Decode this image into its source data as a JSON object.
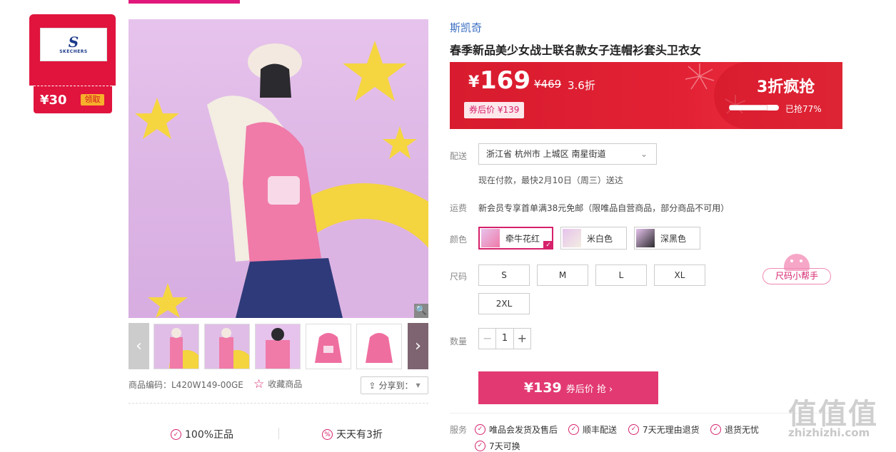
{
  "coupon": {
    "amount": "¥30",
    "claim_label": "领取",
    "brand_logo_text": "SKECHERS"
  },
  "product": {
    "brand": "斯凯奇",
    "title": "春季新品美少女战士联名款女子连帽衫套头卫衣女",
    "code_label": "商品编码：L420W149-00GE",
    "favorite_label": "收藏商品",
    "share_label": "分享到："
  },
  "price": {
    "currency": "¥",
    "current": "169",
    "original": "¥469",
    "discount": "3.6折",
    "after_coupon": "券后价 ¥139",
    "promo_label": "3折疯抢",
    "sold_text": "已抢77%",
    "sold_fraction": 0.77
  },
  "delivery": {
    "label": "配送",
    "address": "浙江省 杭州市 上城区 南星街道",
    "eta": "现在付款，最快2月10日（周三）送达"
  },
  "shipping": {
    "label": "运费",
    "text": "新会员专享首单满38元免邮（限唯品自营商品，部分商品不可用）"
  },
  "color": {
    "label": "颜色",
    "options": [
      "牵牛花红",
      "米白色",
      "深黑色"
    ],
    "selected": "牵牛花红"
  },
  "size": {
    "label": "尺码",
    "options": [
      "S",
      "M",
      "L",
      "XL",
      "2XL"
    ],
    "helper_label": "尺码小帮手"
  },
  "quantity": {
    "label": "数量",
    "value": "1"
  },
  "buy": {
    "price": "¥139",
    "label": "券后价 抢 ›"
  },
  "guarantees": [
    "100%正品",
    "天天有3折"
  ],
  "services": {
    "label": "服务",
    "items": [
      "唯品会发货及售后",
      "顺丰配送",
      "7天无理由退货",
      "退货无忧",
      "7天可换"
    ]
  },
  "watermark": {
    "glyphs": "值值值",
    "site": "zhizhizhi.com"
  },
  "colors": {
    "accent": "#d6216b",
    "price_red": "#e0143d",
    "buy_button": "#e23972",
    "brand_blue": "#3a6ec2"
  }
}
